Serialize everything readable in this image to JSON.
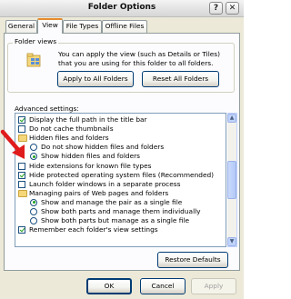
{
  "window": {
    "title": "Folder Options",
    "help_label": "?",
    "close_label": "✕"
  },
  "tabs": [
    {
      "label": "General"
    },
    {
      "label": "View"
    },
    {
      "label": "File Types"
    },
    {
      "label": "Offline Files"
    }
  ],
  "folder_views": {
    "label": "Folder views",
    "icon": "folder-views-icon",
    "description": "You can apply the view (such as Details or Tiles) that you are using for this folder to all folders.",
    "apply_all_label": "Apply to All Folders",
    "reset_all_label": "Reset All Folders"
  },
  "advanced": {
    "label": "Advanced settings:",
    "items": [
      {
        "type": "checkbox",
        "checked": true,
        "indent": 0,
        "label": "Display the full path in the title bar"
      },
      {
        "type": "checkbox",
        "checked": false,
        "indent": 0,
        "label": "Do not cache thumbnails"
      },
      {
        "type": "folder",
        "indent": 0,
        "label": "Hidden files and folders"
      },
      {
        "type": "radio",
        "checked": false,
        "indent": 1,
        "label": "Do not show hidden files and folders"
      },
      {
        "type": "radio",
        "checked": true,
        "indent": 1,
        "label": "Show hidden files and folders"
      },
      {
        "type": "checkbox",
        "checked": false,
        "indent": 0,
        "label": "Hide extensions for known file types"
      },
      {
        "type": "checkbox",
        "checked": true,
        "indent": 0,
        "label": "Hide protected operating system files (Recommended)"
      },
      {
        "type": "checkbox",
        "checked": false,
        "indent": 0,
        "label": "Launch folder windows in a separate process"
      },
      {
        "type": "folder",
        "indent": 0,
        "label": "Managing pairs of Web pages and folders"
      },
      {
        "type": "radio",
        "checked": true,
        "indent": 1,
        "label": "Show and manage the pair as a single file"
      },
      {
        "type": "radio",
        "checked": false,
        "indent": 1,
        "label": "Show both parts and manage them individually"
      },
      {
        "type": "radio",
        "checked": false,
        "indent": 1,
        "label": "Show both parts but manage as a single file"
      },
      {
        "type": "checkbox",
        "checked": true,
        "indent": 0,
        "label": "Remember each folder's view settings"
      }
    ],
    "restore_defaults_label": "Restore Defaults"
  },
  "footer": {
    "ok_label": "OK",
    "cancel_label": "Cancel",
    "apply_label": "Apply"
  },
  "colors": {
    "annotation_arrow": "#e01b1b",
    "tab_highlight": "#e68b2c"
  }
}
